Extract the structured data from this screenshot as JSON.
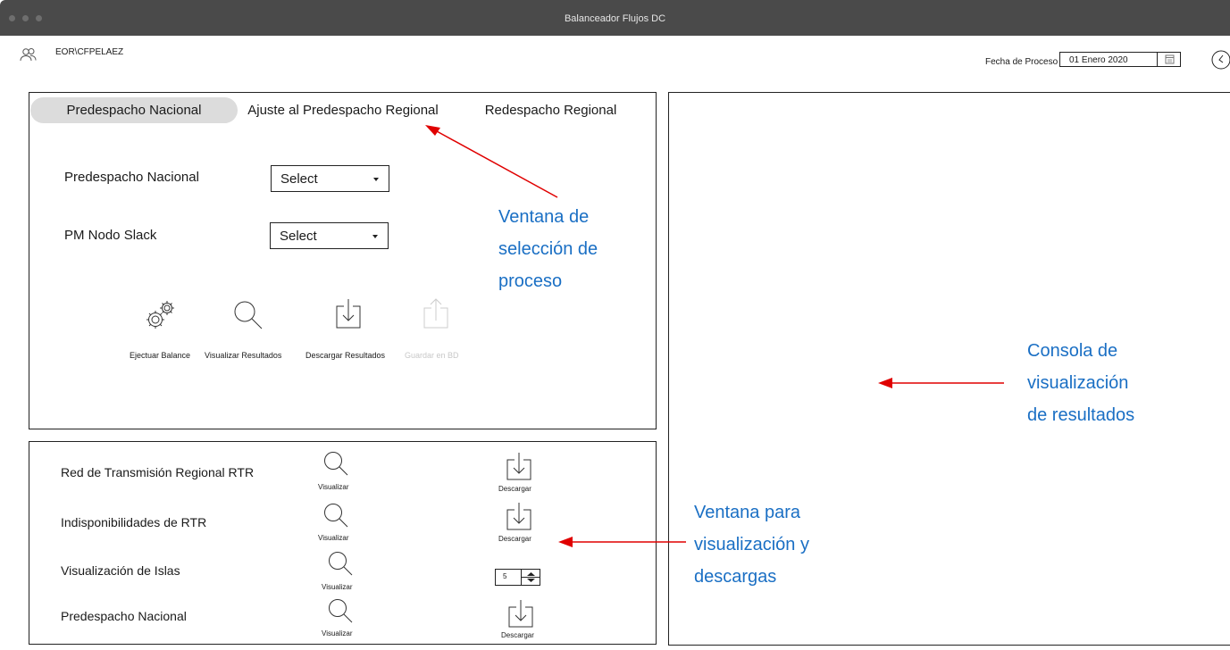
{
  "window": {
    "title": "Balanceador Flujos DC"
  },
  "header": {
    "user": "EOR\\CFPELAEZ",
    "date_label": "Fecha de Proceso",
    "date_value": "01 Enero 2020"
  },
  "tabs": [
    {
      "label": "Predespacho Nacional",
      "active": true
    },
    {
      "label": "Ajuste al Predespacho Regional",
      "active": false
    },
    {
      "label": "Redespacho Regional",
      "active": false
    }
  ],
  "form": {
    "fields": [
      {
        "label": "Predespacho Nacional",
        "value": "Select"
      },
      {
        "label": "PM Nodo Slack",
        "value": "Select"
      }
    ]
  },
  "actions": [
    {
      "label": "Ejectuar Balance",
      "icon": "gears-icon",
      "enabled": true
    },
    {
      "label": "Visualizar Resultados",
      "icon": "magnifier-icon",
      "enabled": true
    },
    {
      "label": "Descargar Resultados",
      "icon": "download-icon",
      "enabled": true
    },
    {
      "label": "Guardar en BD",
      "icon": "upload-icon",
      "enabled": false
    }
  ],
  "downloads": {
    "rows": [
      {
        "label": "Red de Transmisión Regional RTR",
        "view": "Visualizar",
        "download": "Descargar"
      },
      {
        "label": "Indisponibilidades de RTR",
        "view": "Visualizar",
        "download": "Descargar"
      },
      {
        "label": "Visualización de Islas",
        "view": "Visualizar",
        "stepper_value": "5"
      },
      {
        "label": "Predespacho Nacional",
        "view": "Visualizar",
        "download": "Descargar"
      }
    ]
  },
  "annotations": {
    "process": [
      "Ventana de",
      "selección de",
      "proceso"
    ],
    "console": [
      "Consola de",
      "visualización",
      "de resultados"
    ],
    "downloads": [
      "Ventana para",
      "visualización y",
      "descargas"
    ]
  },
  "colors": {
    "annotation": "#1a6fc4",
    "arrow": "#e00000",
    "titlebar": "#4a4a4a",
    "active_tab": "#dcdcdc"
  }
}
